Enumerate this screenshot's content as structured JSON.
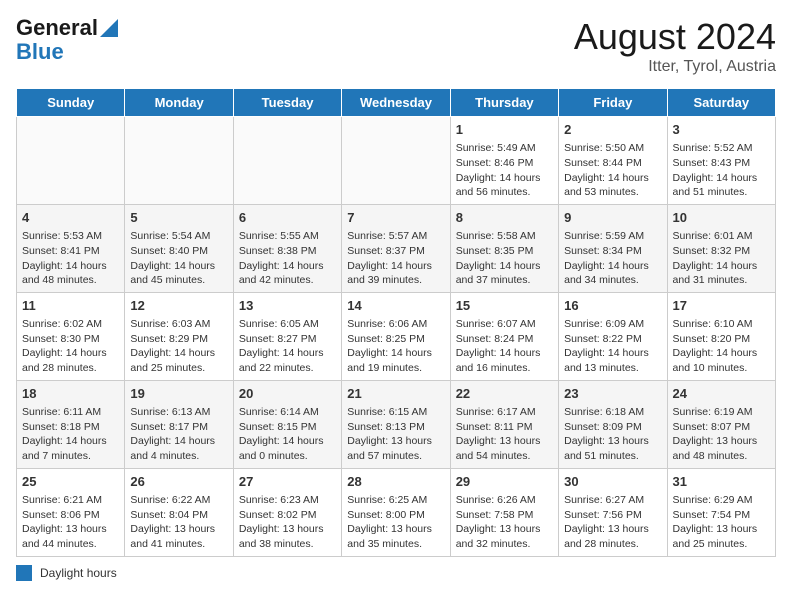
{
  "header": {
    "logo_line1": "General",
    "logo_line2": "Blue",
    "title": "August 2024",
    "subtitle": "Itter, Tyrol, Austria"
  },
  "days_of_week": [
    "Sunday",
    "Monday",
    "Tuesday",
    "Wednesday",
    "Thursday",
    "Friday",
    "Saturday"
  ],
  "weeks": [
    [
      {
        "day": "",
        "info": ""
      },
      {
        "day": "",
        "info": ""
      },
      {
        "day": "",
        "info": ""
      },
      {
        "day": "",
        "info": ""
      },
      {
        "day": "1",
        "info": "Sunrise: 5:49 AM\nSunset: 8:46 PM\nDaylight: 14 hours\nand 56 minutes."
      },
      {
        "day": "2",
        "info": "Sunrise: 5:50 AM\nSunset: 8:44 PM\nDaylight: 14 hours\nand 53 minutes."
      },
      {
        "day": "3",
        "info": "Sunrise: 5:52 AM\nSunset: 8:43 PM\nDaylight: 14 hours\nand 51 minutes."
      }
    ],
    [
      {
        "day": "4",
        "info": "Sunrise: 5:53 AM\nSunset: 8:41 PM\nDaylight: 14 hours\nand 48 minutes."
      },
      {
        "day": "5",
        "info": "Sunrise: 5:54 AM\nSunset: 8:40 PM\nDaylight: 14 hours\nand 45 minutes."
      },
      {
        "day": "6",
        "info": "Sunrise: 5:55 AM\nSunset: 8:38 PM\nDaylight: 14 hours\nand 42 minutes."
      },
      {
        "day": "7",
        "info": "Sunrise: 5:57 AM\nSunset: 8:37 PM\nDaylight: 14 hours\nand 39 minutes."
      },
      {
        "day": "8",
        "info": "Sunrise: 5:58 AM\nSunset: 8:35 PM\nDaylight: 14 hours\nand 37 minutes."
      },
      {
        "day": "9",
        "info": "Sunrise: 5:59 AM\nSunset: 8:34 PM\nDaylight: 14 hours\nand 34 minutes."
      },
      {
        "day": "10",
        "info": "Sunrise: 6:01 AM\nSunset: 8:32 PM\nDaylight: 14 hours\nand 31 minutes."
      }
    ],
    [
      {
        "day": "11",
        "info": "Sunrise: 6:02 AM\nSunset: 8:30 PM\nDaylight: 14 hours\nand 28 minutes."
      },
      {
        "day": "12",
        "info": "Sunrise: 6:03 AM\nSunset: 8:29 PM\nDaylight: 14 hours\nand 25 minutes."
      },
      {
        "day": "13",
        "info": "Sunrise: 6:05 AM\nSunset: 8:27 PM\nDaylight: 14 hours\nand 22 minutes."
      },
      {
        "day": "14",
        "info": "Sunrise: 6:06 AM\nSunset: 8:25 PM\nDaylight: 14 hours\nand 19 minutes."
      },
      {
        "day": "15",
        "info": "Sunrise: 6:07 AM\nSunset: 8:24 PM\nDaylight: 14 hours\nand 16 minutes."
      },
      {
        "day": "16",
        "info": "Sunrise: 6:09 AM\nSunset: 8:22 PM\nDaylight: 14 hours\nand 13 minutes."
      },
      {
        "day": "17",
        "info": "Sunrise: 6:10 AM\nSunset: 8:20 PM\nDaylight: 14 hours\nand 10 minutes."
      }
    ],
    [
      {
        "day": "18",
        "info": "Sunrise: 6:11 AM\nSunset: 8:18 PM\nDaylight: 14 hours\nand 7 minutes."
      },
      {
        "day": "19",
        "info": "Sunrise: 6:13 AM\nSunset: 8:17 PM\nDaylight: 14 hours\nand 4 minutes."
      },
      {
        "day": "20",
        "info": "Sunrise: 6:14 AM\nSunset: 8:15 PM\nDaylight: 14 hours\nand 0 minutes."
      },
      {
        "day": "21",
        "info": "Sunrise: 6:15 AM\nSunset: 8:13 PM\nDaylight: 13 hours\nand 57 minutes."
      },
      {
        "day": "22",
        "info": "Sunrise: 6:17 AM\nSunset: 8:11 PM\nDaylight: 13 hours\nand 54 minutes."
      },
      {
        "day": "23",
        "info": "Sunrise: 6:18 AM\nSunset: 8:09 PM\nDaylight: 13 hours\nand 51 minutes."
      },
      {
        "day": "24",
        "info": "Sunrise: 6:19 AM\nSunset: 8:07 PM\nDaylight: 13 hours\nand 48 minutes."
      }
    ],
    [
      {
        "day": "25",
        "info": "Sunrise: 6:21 AM\nSunset: 8:06 PM\nDaylight: 13 hours\nand 44 minutes."
      },
      {
        "day": "26",
        "info": "Sunrise: 6:22 AM\nSunset: 8:04 PM\nDaylight: 13 hours\nand 41 minutes."
      },
      {
        "day": "27",
        "info": "Sunrise: 6:23 AM\nSunset: 8:02 PM\nDaylight: 13 hours\nand 38 minutes."
      },
      {
        "day": "28",
        "info": "Sunrise: 6:25 AM\nSunset: 8:00 PM\nDaylight: 13 hours\nand 35 minutes."
      },
      {
        "day": "29",
        "info": "Sunrise: 6:26 AM\nSunset: 7:58 PM\nDaylight: 13 hours\nand 32 minutes."
      },
      {
        "day": "30",
        "info": "Sunrise: 6:27 AM\nSunset: 7:56 PM\nDaylight: 13 hours\nand 28 minutes."
      },
      {
        "day": "31",
        "info": "Sunrise: 6:29 AM\nSunset: 7:54 PM\nDaylight: 13 hours\nand 25 minutes."
      }
    ]
  ],
  "legend": {
    "box_color": "#2176b8",
    "label": "Daylight hours"
  }
}
